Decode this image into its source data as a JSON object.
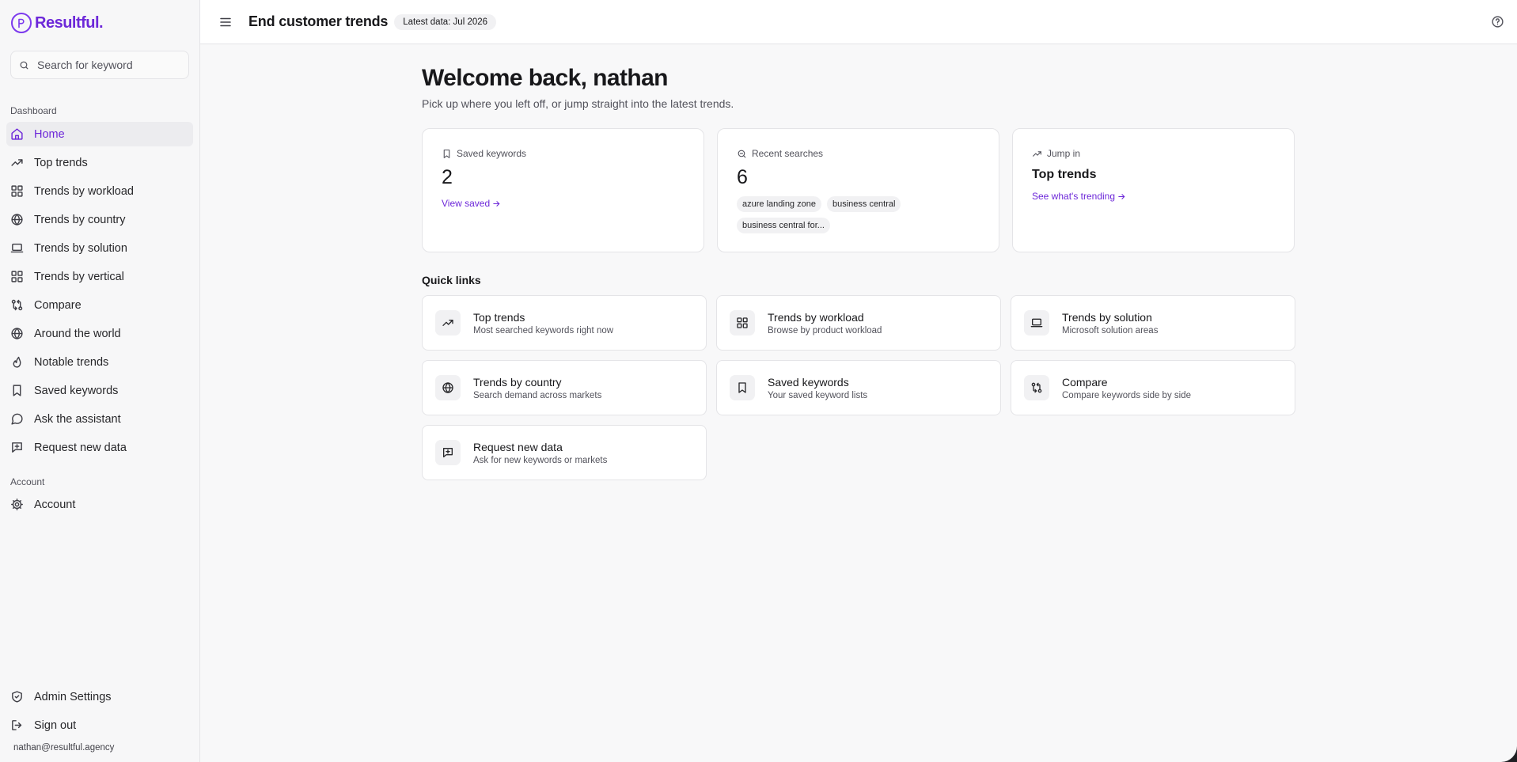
{
  "brand": {
    "name": "Resultful.",
    "accent": "#6d28d9"
  },
  "search": {
    "placeholder": "Search for keyword",
    "value": ""
  },
  "sidebar": {
    "section_dashboard": "Dashboard",
    "items": [
      {
        "label": "Home",
        "icon": "home-icon",
        "active": true
      },
      {
        "label": "Top trends",
        "icon": "trending-up-icon"
      },
      {
        "label": "Trends by workload",
        "icon": "grid-icon"
      },
      {
        "label": "Trends by country",
        "icon": "globe-icon"
      },
      {
        "label": "Trends by solution",
        "icon": "laptop-icon"
      },
      {
        "label": "Trends by vertical",
        "icon": "grid-icon"
      },
      {
        "label": "Compare",
        "icon": "compare-icon"
      },
      {
        "label": "Around the world",
        "icon": "globe-icon"
      },
      {
        "label": "Notable trends",
        "icon": "flame-icon"
      },
      {
        "label": "Saved keywords",
        "icon": "bookmark-icon"
      },
      {
        "label": "Ask the assistant",
        "icon": "message-circle-icon"
      },
      {
        "label": "Request new data",
        "icon": "message-plus-icon"
      }
    ],
    "section_account": "Account",
    "account_item": {
      "label": "Account",
      "icon": "gear-icon"
    },
    "admin": {
      "label": "Admin Settings",
      "icon": "shield-icon"
    },
    "signout": {
      "label": "Sign out",
      "icon": "sign-out-icon"
    },
    "email": "nathan@resultful.agency"
  },
  "header": {
    "title": "End customer trends",
    "badge": "Latest data: Jul 2026"
  },
  "main": {
    "welcome": "Welcome back, nathan",
    "subtitle": "Pick up where you left off, or jump straight into the latest trends.",
    "saved": {
      "label": "Saved keywords",
      "count": "2",
      "link": "View saved"
    },
    "recent": {
      "label": "Recent searches",
      "count": "6",
      "chips": [
        "azure landing zone",
        "business central",
        "business central for..."
      ]
    },
    "jump": {
      "label": "Jump in",
      "title": "Top trends",
      "link": "See what's trending"
    },
    "quick_label": "Quick links",
    "quick_links": [
      {
        "title": "Top trends",
        "desc": "Most searched keywords right now",
        "icon": "trending-up-icon"
      },
      {
        "title": "Trends by workload",
        "desc": "Browse by product workload",
        "icon": "grid-icon"
      },
      {
        "title": "Trends by solution",
        "desc": "Microsoft solution areas",
        "icon": "laptop-icon"
      },
      {
        "title": "Trends by country",
        "desc": "Search demand across markets",
        "icon": "globe-icon"
      },
      {
        "title": "Saved keywords",
        "desc": "Your saved keyword lists",
        "icon": "bookmark-icon"
      },
      {
        "title": "Compare",
        "desc": "Compare keywords side by side",
        "icon": "compare-icon"
      },
      {
        "title": "Request new data",
        "desc": "Ask for new keywords or markets",
        "icon": "message-plus-icon"
      }
    ]
  }
}
